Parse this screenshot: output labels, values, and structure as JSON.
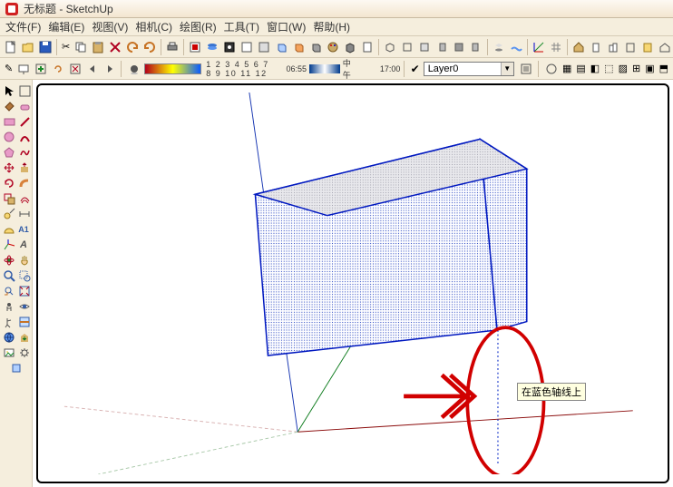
{
  "title": "无标题 - SketchUp",
  "menu": [
    "文件(F)",
    "编辑(E)",
    "视图(V)",
    "相机(C)",
    "绘图(R)",
    "工具(T)",
    "窗口(W)",
    "帮助(H)"
  ],
  "scale_numbers": "1  2  3  4  5  6  7  8  9 10 11 12",
  "time_left": "06:55",
  "time_mid": "中午",
  "time_right": "17:00",
  "layer": {
    "check": "✔",
    "name": "Layer0"
  },
  "tooltip": "在蓝色轴线上",
  "chart_data": {
    "type": "diagram",
    "description": "SketchUp 3D viewport showing a rectangular box/cube (blue halftone shaded faces, blue edges) positioned above the origin. Green, red, and blue model axes visible. A dashed blue construction line extends downward from a lower corner of the box along the blue (vertical) axis with inference tooltip '在蓝色轴线上'. Red hand-drawn arrow and red ellipse annotate this vertical blue guide line.",
    "axes": [
      "red (x)",
      "green (y)",
      "blue (z)"
    ]
  }
}
